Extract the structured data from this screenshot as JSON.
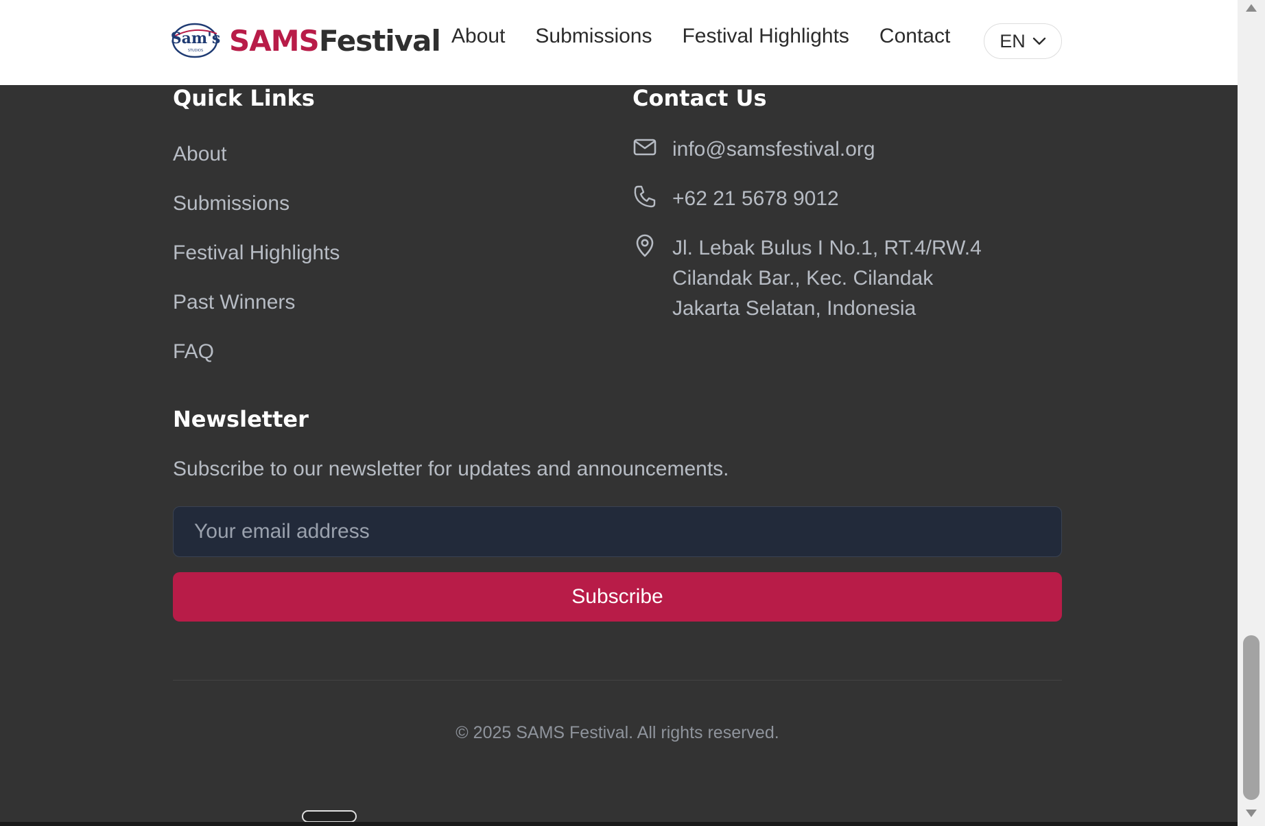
{
  "header": {
    "logo_icon": "sams-studios-emblem",
    "brand_part1": "SAMS",
    "brand_part2": "Festival",
    "nav": [
      {
        "label": "About"
      },
      {
        "label": "Submissions"
      },
      {
        "label": "Festival Highlights"
      },
      {
        "label": "Contact"
      }
    ],
    "language": {
      "selected": "EN",
      "icon": "chevron-down-icon"
    }
  },
  "quick_links": {
    "title": "Quick Links",
    "items": [
      {
        "label": "About"
      },
      {
        "label": "Submissions"
      },
      {
        "label": "Festival Highlights"
      },
      {
        "label": "Past Winners"
      },
      {
        "label": "FAQ"
      }
    ]
  },
  "contact": {
    "title": "Contact Us",
    "email": {
      "icon": "mail-icon",
      "value": "info@samsfestival.org"
    },
    "phone": {
      "icon": "phone-icon",
      "value": "+62 21 5678 9012"
    },
    "address": {
      "icon": "map-pin-icon",
      "lines": [
        "Jl. Lebak Bulus I No.1, RT.4/RW.4",
        "Cilandak Bar., Kec. Cilandak",
        "Jakarta Selatan, Indonesia"
      ]
    }
  },
  "newsletter": {
    "title": "Newsletter",
    "description": "Subscribe to our newsletter for updates and announcements.",
    "email_placeholder": "Your email address",
    "email_value": "",
    "subscribe_label": "Subscribe"
  },
  "footer": {
    "copyright": "© 2025 SAMS Festival. All rights reserved."
  },
  "colors": {
    "accent": "#b81c48",
    "background": "#333333",
    "header_bg": "#ffffff",
    "input_bg": "#222a3a"
  }
}
